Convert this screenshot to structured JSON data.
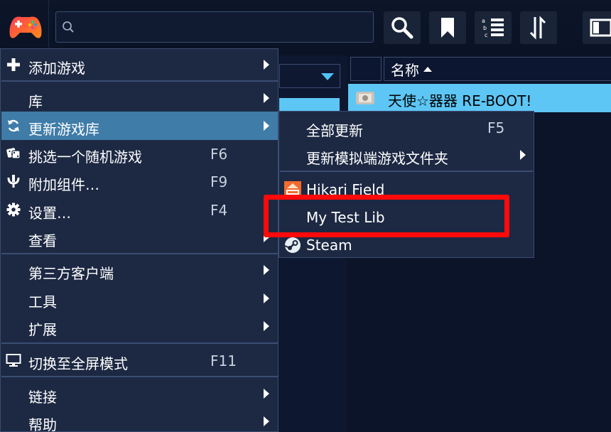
{
  "toolbar": {
    "search_placeholder": "",
    "logo_icon": "gamepad-logo-icon",
    "buttons": [
      "search-icon",
      "bookmark-icon",
      "sort-list-icon",
      "sort-order-icon",
      "panel-toggle-icon"
    ]
  },
  "list": {
    "column_name": "名称",
    "selected_game": "天使☆器器 RE-BOOT!"
  },
  "menu": {
    "items": [
      {
        "label": "添加游戏",
        "icon": "plus-icon",
        "shortcut": "",
        "submenu": true
      },
      {
        "label": "库",
        "icon": "",
        "shortcut": "",
        "submenu": true
      },
      {
        "label": "更新游戏库",
        "icon": "refresh-icon",
        "shortcut": "",
        "submenu": true
      },
      {
        "label": "挑选一个随机游戏",
        "icon": "dice-icon",
        "shortcut": "F6",
        "submenu": false
      },
      {
        "label": "附加组件…",
        "icon": "plugin-icon",
        "shortcut": "F9",
        "submenu": false
      },
      {
        "label": "设置…",
        "icon": "gear-icon",
        "shortcut": "F4",
        "submenu": false
      },
      {
        "label": "查看",
        "icon": "",
        "shortcut": "",
        "submenu": true
      },
      {
        "label": "第三方客户端",
        "icon": "",
        "shortcut": "",
        "submenu": true
      },
      {
        "label": "工具",
        "icon": "",
        "shortcut": "",
        "submenu": true
      },
      {
        "label": "扩展",
        "icon": "",
        "shortcut": "",
        "submenu": true
      },
      {
        "label": "切换至全屏模式",
        "icon": "monitor-icon",
        "shortcut": "F11",
        "submenu": false
      },
      {
        "label": "链接",
        "icon": "",
        "shortcut": "",
        "submenu": true
      },
      {
        "label": "帮助",
        "icon": "",
        "shortcut": "",
        "submenu": true
      }
    ]
  },
  "submenu": {
    "items": [
      {
        "label": "全部更新",
        "shortcut": "F5"
      },
      {
        "label": "更新模拟端游戏文件夹",
        "shortcut": ""
      },
      {
        "label": "Hikari Field",
        "icon": "hikari-field-icon"
      },
      {
        "label": "My Test Lib",
        "icon": ""
      },
      {
        "label": "Steam",
        "icon": "steam-icon"
      }
    ]
  },
  "colors": {
    "accent": "#5dc6f5",
    "menu_bg": "#1d2943",
    "menu_highlight": "#3f7ca8",
    "annotation": "#ff0a0a"
  }
}
